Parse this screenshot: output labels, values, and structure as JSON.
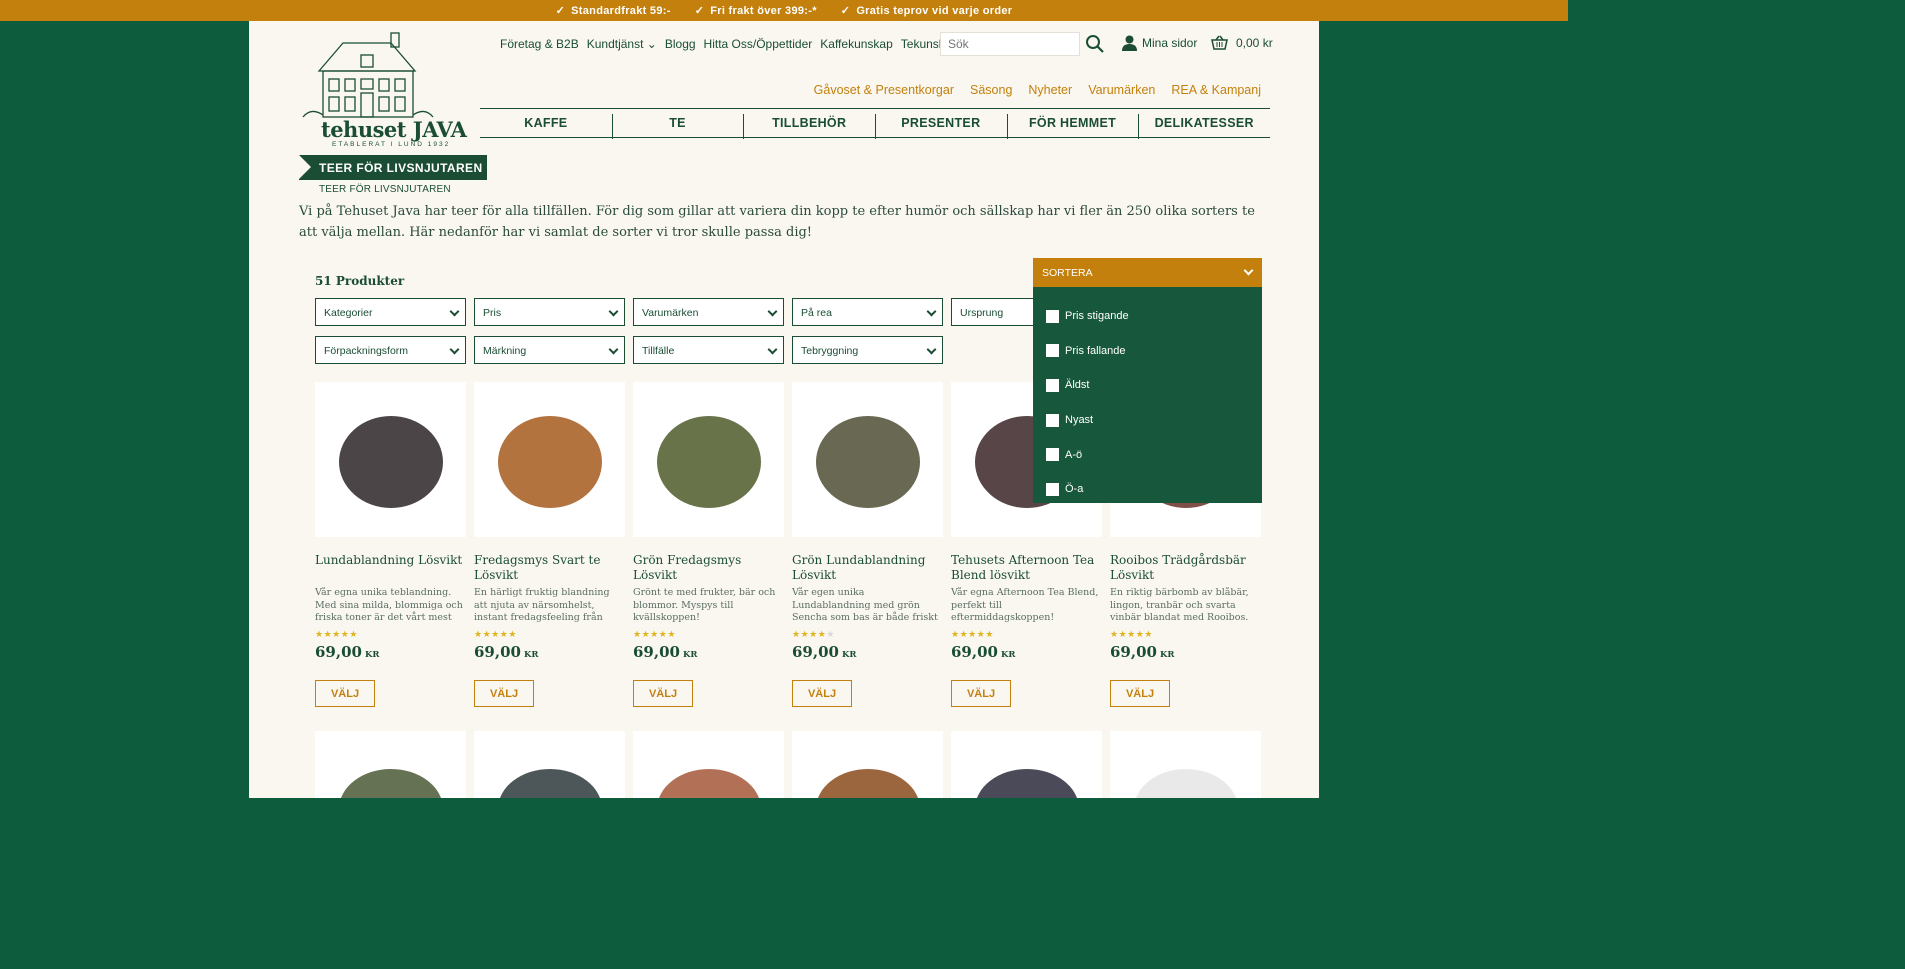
{
  "topbar": {
    "items": [
      "Standardfrakt 59:-",
      "Fri frakt över 399:-*",
      "Gratis teprov vid varje order"
    ]
  },
  "logo": {
    "name": "tehuset JAVA",
    "tagline": "ETABLERAT I LUND 1932"
  },
  "topnav": {
    "items": [
      "Företag & B2B",
      "Kundtjänst",
      "Blogg",
      "Hitta Oss/Öppettider",
      "Kaffekunskap",
      "Tekunskap"
    ],
    "search_placeholder": "Sök",
    "account_label": "Mina sidor",
    "cart_total": "0,00 kr"
  },
  "secnav": {
    "items": [
      "Gåvoset & Presentkorgar",
      "Säsong",
      "Nyheter",
      "Varumärken",
      "REA & Kampanj"
    ]
  },
  "mainnav": {
    "items": [
      "KAFFE",
      "TE",
      "TILLBEHÖR",
      "PRESENTER",
      "FÖR HEMMET",
      "DELIKATESSER"
    ]
  },
  "page": {
    "banner": "TEER FÖR LIVSNJUTAREN",
    "breadcrumb": "TEER FÖR LIVSNJUTAREN",
    "intro": "Vi på Tehuset Java har teer för alla tillfällen. För dig som gillar att variera din kopp te efter humör och sällskap har vi fler än 250 olika sorters te att välja mellan. Här nedanför har vi samlat de sorter vi tror skulle passa dig!",
    "count": "51 Produkter"
  },
  "filters": [
    "Kategorier",
    "Pris",
    "Varumärken",
    "På rea",
    "Ursprung",
    "Förpackningsform",
    "Märkning",
    "Tillfälle",
    "Tebryggning"
  ],
  "sort": {
    "label": "SORTERA",
    "options": [
      "Pris stigande",
      "Pris fallande",
      "Äldst",
      "Nyast",
      "A-ö",
      "Ö-a"
    ]
  },
  "products": [
    {
      "name": "Lundablandning Lösvikt",
      "desc": "Vår egna unika teblandning. Med sina milda, blommiga och friska toner är det vårt mest",
      "rating": 5,
      "price": "69,00",
      "currency": "KR",
      "button": "VÄLJ",
      "color": "#2b2528"
    },
    {
      "name": "Fredagsmys Svart te Lösvikt",
      "desc": "En härligt fruktig blandning att njuta av närsomhelst, instant fredagsfeeling från tekoppen!",
      "rating": 5,
      "price": "69,00",
      "currency": "KR",
      "button": "VÄLJ",
      "color": "#a65a1c"
    },
    {
      "name": "Grön Fredagsmys Lösvikt",
      "desc": "Grönt te med frukter, bär och blommor. Myspys till kvällskoppen!",
      "rating": 5,
      "price": "69,00",
      "currency": "KR",
      "button": "VÄLJ",
      "color": "#4d5a2a"
    },
    {
      "name": "Grön Lundablandning Lösvikt",
      "desc": "Vår egen unika Lundablandning med grön Sencha som bas är både friskt och mjukt i smaken.",
      "rating": 4,
      "price": "69,00",
      "currency": "KR",
      "button": "VÄLJ",
      "color": "#4e4d35"
    },
    {
      "name": "Tehusets Afternoon Tea Blend lösvikt",
      "desc": "Vår egna Afternoon Tea Blend, perfekt till eftermiddagskoppen! Trädgårdsblommig och",
      "rating": 5,
      "price": "69,00",
      "currency": "KR",
      "button": "VÄLJ",
      "color": "#3a2528"
    },
    {
      "name": "Rooibos Trädgårdsbär Lösvikt",
      "desc": "En riktig bärbomb av blåbär, lingon, tranbär och svarta vinbär blandat med Rooibos.",
      "rating": 5,
      "price": "69,00",
      "currency": "KR",
      "button": "VÄLJ",
      "color": "#6a3028"
    }
  ],
  "row2_colors": [
    "#4a5a36",
    "#2e3a3c",
    "#a5583a",
    "#8a4a1c",
    "#2a2a3c",
    "#e5e5e5"
  ],
  "colors": {
    "brand_green": "#0d5c3d",
    "accent_gold": "#c3800d",
    "page_bg": "#faf7f1"
  }
}
